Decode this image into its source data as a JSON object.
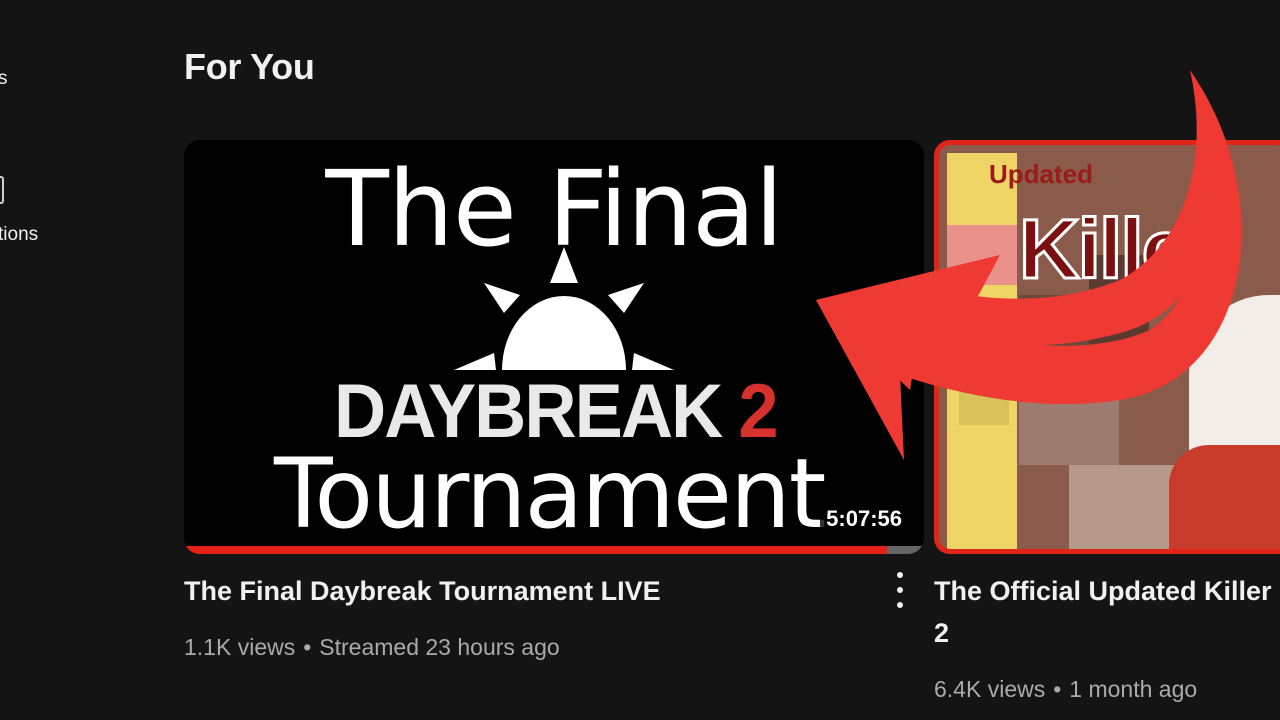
{
  "sidebar": {
    "item1_fragment": "s",
    "item2_fragment": "tions"
  },
  "section": {
    "title": "For You"
  },
  "videos": [
    {
      "title": "The Final Daybreak Tournament LIVE",
      "views": "1.1K views",
      "age": "Streamed 23 hours ago",
      "duration": "5:07:56",
      "progress_fraction": 0.95,
      "thumbnail": {
        "line1": "The Final",
        "line2": "DAYBREAK",
        "line2_num": "2",
        "line3": "Tournament"
      }
    },
    {
      "title_line1": "The Official Updated Killer",
      "title_line2": "2",
      "views": "6.4K views",
      "age": "1 month ago",
      "thumbnail": {
        "label_small": "Updated",
        "label_big": "Killer"
      }
    }
  ],
  "separator": "•",
  "icons": {
    "more": "more-vert-icon",
    "sun": "sun-logo-icon",
    "arrow": "curved-arrow-annotation"
  },
  "colors": {
    "accent": "#e62117",
    "arrow": "#ee3a32",
    "background": "#141414",
    "meta": "#aaaaaa"
  }
}
